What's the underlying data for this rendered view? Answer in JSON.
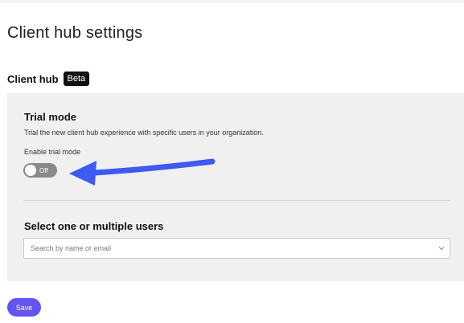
{
  "page": {
    "title": "Client hub settings"
  },
  "section": {
    "title": "Client hub",
    "badge": "Beta"
  },
  "trial_mode": {
    "title": "Trial mode",
    "description": "Trial the new client hub experience with specific users in your organization.",
    "toggle_label": "Enable trial mode",
    "toggle_state": "Off"
  },
  "users": {
    "title": "Select one or multiple users",
    "search_placeholder": "Search by name or email",
    "search_value": ""
  },
  "actions": {
    "save_label": "Save"
  },
  "colors": {
    "accent": "#6454f0",
    "annotation_arrow": "#3d5af1"
  },
  "icons": {
    "dropdown": "chevron-down-icon",
    "annotation": "arrow-annotation"
  }
}
